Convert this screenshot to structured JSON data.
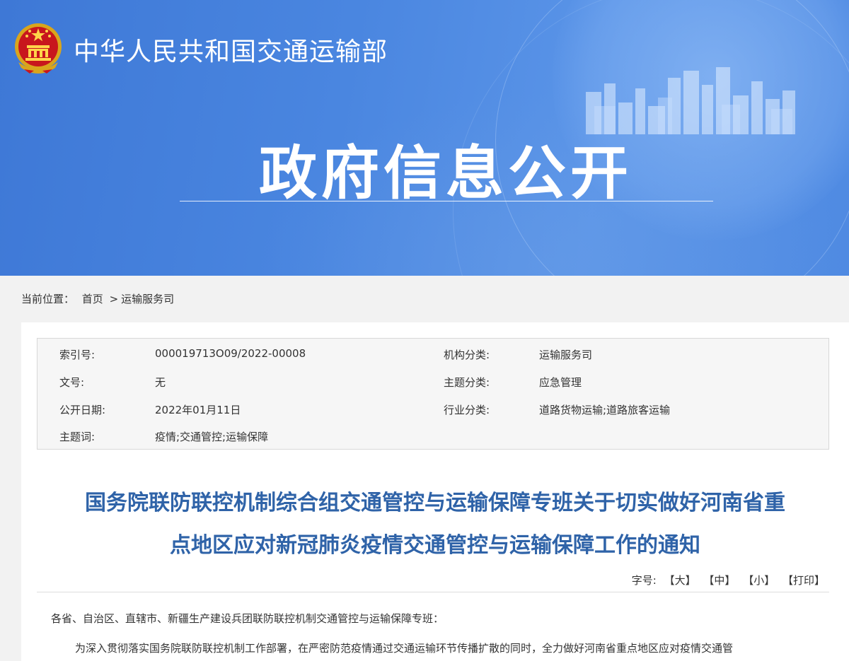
{
  "header": {
    "site_title": "中华人民共和国交通运输部",
    "section_title": "政府信息公开"
  },
  "breadcrumb": {
    "label": "当前位置：",
    "items": [
      "首页",
      "运输服务司"
    ],
    "separator": ">"
  },
  "metadata": {
    "index_label": "索引号:",
    "index_value": "000019713O09/2022-00008",
    "org_label": "机构分类:",
    "org_value": "运输服务司",
    "doc_no_label": "文号:",
    "doc_no_value": "无",
    "topic_label": "主题分类:",
    "topic_value": "应急管理",
    "date_label": "公开日期:",
    "date_value": "2022年01月11日",
    "industry_label": "行业分类:",
    "industry_value": "道路货物运输;道路旅客运输",
    "keywords_label": "主题词:",
    "keywords_value": "疫情;交通管控;运输保障"
  },
  "document": {
    "title_line1": "国务院联防联控机制综合组交通管控与运输保障专班关于切实做好河南省重",
    "title_line2": "点地区应对新冠肺炎疫情交通管控与运输保障工作的通知",
    "fontsize_label": "字号:",
    "fontsize_large": "【大】",
    "fontsize_medium": "【中】",
    "fontsize_small": "【小】",
    "print": "【打印】",
    "salutation": "各省、自治区、直辖市、新疆生产建设兵团联防联控机制交通管控与运输保障专班：",
    "body_first_line": "为深入贯彻落实国务院联防联控机制工作部署，在严密防范疫情通过交通运输环节传播扩散的同时，全力做好河南省重点地区应对疫情交通管"
  },
  "colors": {
    "banner": "#4a86e0",
    "title_blue": "#2f63a8",
    "page_bg": "#f2f2f2",
    "meta_bg": "#f6f6f6"
  },
  "icons": [
    "national-emblem-icon",
    "city-skyline-decoration"
  ]
}
